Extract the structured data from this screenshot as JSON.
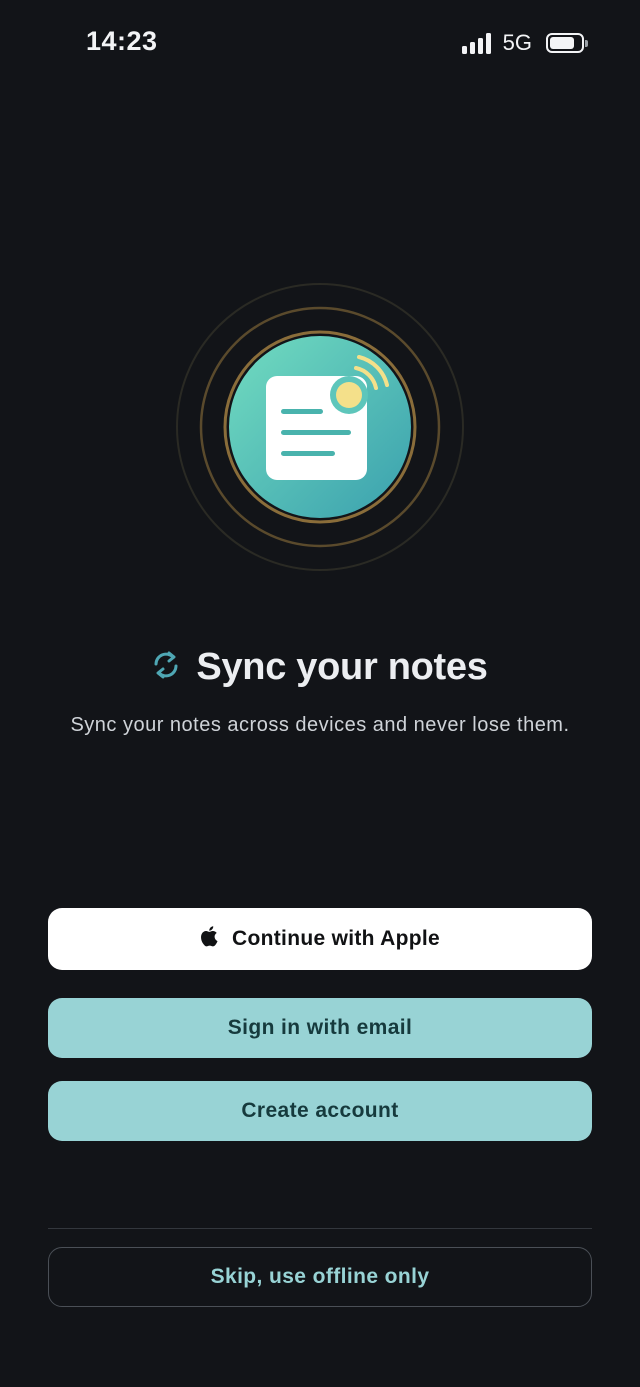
{
  "status_bar": {
    "time": "14:23",
    "network": "5G",
    "signal_icon": "cellular-signal-icon",
    "battery_icon": "battery-icon"
  },
  "hero": {
    "icon": "note-sync-illustration",
    "colors": {
      "gradient_start": "#6fd8be",
      "gradient_end": "#3aa6b0",
      "ring": "#6b5a35",
      "badge": "#f4e08a",
      "note": "#ffffff",
      "note_lines": "#49b3ad"
    }
  },
  "header": {
    "icon": "sync-icon",
    "title": "Sync your notes",
    "subtitle": "Sync your notes across devices and never lose them."
  },
  "actions": {
    "apple": {
      "icon": "apple-logo-icon",
      "label": "Continue with Apple"
    },
    "email_label": "Sign in with email",
    "create_label": "Create account",
    "skip_label": "Skip, use offline only"
  },
  "colors": {
    "background": "#121418",
    "accent": "#98d3d5",
    "accent_text": "#163a3d"
  }
}
